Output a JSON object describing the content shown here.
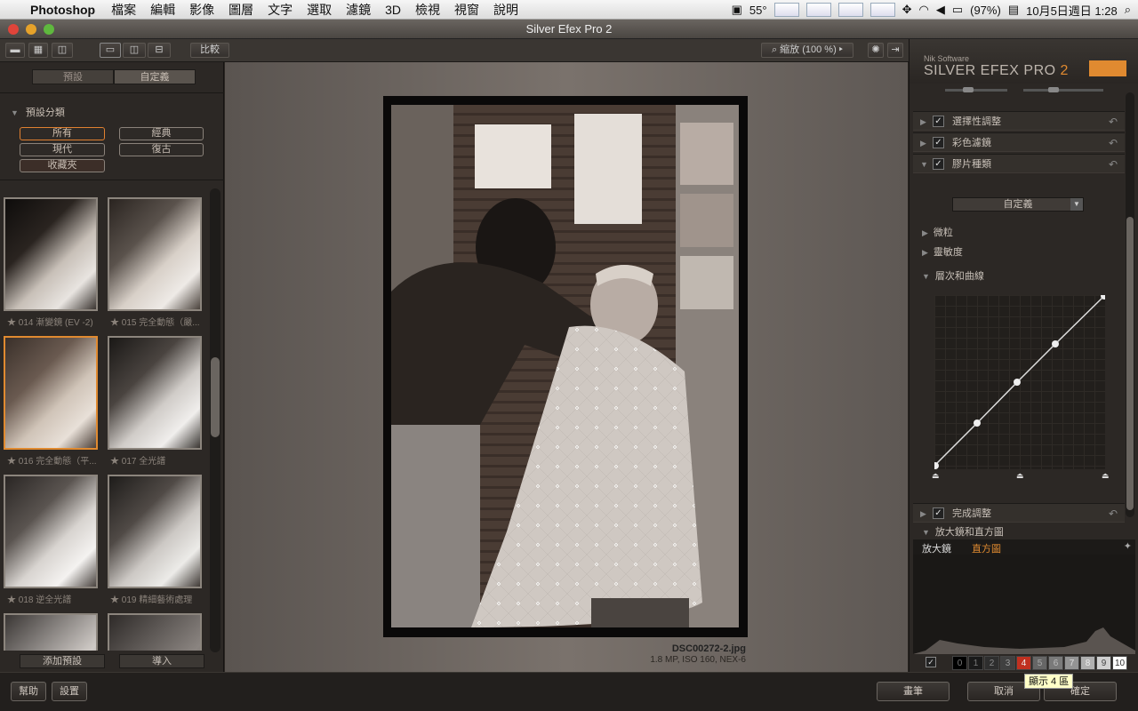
{
  "menubar": {
    "app": "Photoshop",
    "items": [
      "檔案",
      "編輯",
      "影像",
      "圖層",
      "文字",
      "選取",
      "濾鏡",
      "3D",
      "檢視",
      "視窗",
      "說明"
    ],
    "temp": "55°",
    "battery": "(97%)",
    "datetime": "10月5日週日  1:28"
  },
  "window": {
    "title": "Silver Efex Pro 2"
  },
  "toolbar": {
    "compare": "比較",
    "zoom": "縮放 (100 %)"
  },
  "left": {
    "tab_presets": "預設",
    "tab_custom": "自定義",
    "category_title": "預設分類",
    "categories": [
      "所有",
      "經典",
      "現代",
      "復古",
      "收藏夾"
    ],
    "thumbs": [
      {
        "label": "★ 014 漸變鏡 (EV -2)"
      },
      {
        "label": "★ 015 完全動態（嚴..."
      },
      {
        "label": "★ 016 完全動態（平..."
      },
      {
        "label": "★ 017 全光譜"
      },
      {
        "label": "★ 018 逆全光譜"
      },
      {
        "label": "★ 019 精細藝術處理"
      },
      {
        "label": ""
      },
      {
        "label": ""
      }
    ],
    "add_preset": "添加預設",
    "import": "導入"
  },
  "center": {
    "filename": "DSC00272-2.jpg",
    "info": "1.8 MP, ISO 160, NEX-6"
  },
  "right": {
    "brand_small": "Nik Software",
    "brand_title": "SILVER EFEX PRO",
    "brand_ver": "2",
    "sections": [
      {
        "label": "選擇性調整"
      },
      {
        "label": "彩色濾鏡"
      },
      {
        "label": "膠片種類"
      }
    ],
    "film_select": "自定義",
    "sub_grain": "微粒",
    "sub_sensitivity": "靈敏度",
    "sub_curves": "層次和曲線",
    "finishing": "完成調整",
    "loupe_section": "放大鏡和直方圖",
    "tab_loupe": "放大鏡",
    "tab_histogram": "直方圖",
    "zones": [
      "0",
      "1",
      "2",
      "3",
      "4",
      "5",
      "6",
      "7",
      "8",
      "9",
      "10"
    ],
    "tooltip": "顯示 4 區"
  },
  "bottom": {
    "help": "幫助",
    "settings": "設置",
    "brush": "畫筆",
    "cancel": "取消",
    "ok": "確定"
  },
  "colors": {
    "accent": "#e08a30",
    "zone_active": "#c03020"
  }
}
